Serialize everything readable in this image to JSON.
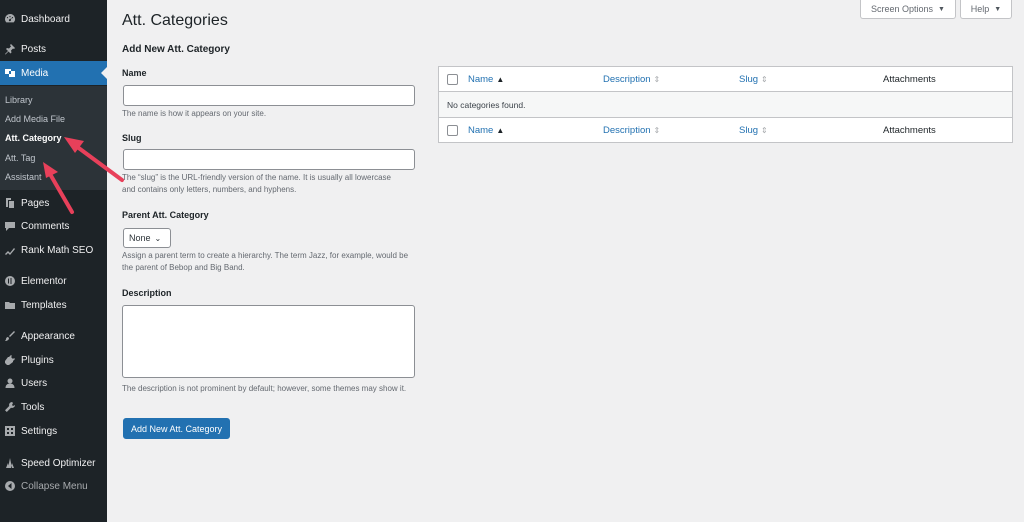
{
  "sidebar": {
    "items": [
      {
        "id": "dashboard",
        "label": "Dashboard",
        "icon": "dashboard-icon"
      },
      {
        "id": "posts",
        "label": "Posts",
        "icon": "pin-icon"
      },
      {
        "id": "media",
        "label": "Media",
        "icon": "media-icon"
      },
      {
        "id": "pages",
        "label": "Pages",
        "icon": "page-icon"
      },
      {
        "id": "comments",
        "label": "Comments",
        "icon": "comment-icon"
      },
      {
        "id": "rankmath",
        "label": "Rank Math SEO",
        "icon": "chart-icon"
      },
      {
        "id": "elementor",
        "label": "Elementor",
        "icon": "elementor-icon"
      },
      {
        "id": "templates",
        "label": "Templates",
        "icon": "folder-icon"
      },
      {
        "id": "appearance",
        "label": "Appearance",
        "icon": "brush-icon"
      },
      {
        "id": "plugins",
        "label": "Plugins",
        "icon": "plug-icon"
      },
      {
        "id": "users",
        "label": "Users",
        "icon": "user-icon"
      },
      {
        "id": "tools",
        "label": "Tools",
        "icon": "wrench-icon"
      },
      {
        "id": "settings",
        "label": "Settings",
        "icon": "settings-icon"
      },
      {
        "id": "speed",
        "label": "Speed Optimizer",
        "icon": "speed-icon"
      },
      {
        "id": "collapse",
        "label": "Collapse Menu",
        "icon": "collapse-icon"
      }
    ],
    "submenu": [
      "Library",
      "Add Media File",
      "Att. Category",
      "Att. Tag",
      "Assistant"
    ]
  },
  "top": {
    "screen_options": "Screen Options",
    "help": "Help"
  },
  "page_title": "Att. Categories",
  "form": {
    "heading": "Add New Att. Category",
    "name_label": "Name",
    "name_help": "The name is how it appears on your site.",
    "slug_label": "Slug",
    "slug_help": "The “slug” is the URL-friendly version of the name. It is usually all lowercase and contains only letters, numbers, and hyphens.",
    "parent_label": "Parent Att. Category",
    "parent_value": "None",
    "parent_help": "Assign a parent term to create a hierarchy. The term Jazz, for example, would be the parent of Bebop and Big Band.",
    "description_label": "Description",
    "description_help": "The description is not prominent by default; however, some themes may show it.",
    "submit": "Add New Att. Category"
  },
  "table": {
    "columns": [
      "Name",
      "Description",
      "Slug",
      "Attachments"
    ],
    "empty": "No categories found."
  },
  "colors": {
    "accent": "#2271b1",
    "sidebar": "#1d2327",
    "annotation_arrow": "#e8405a"
  }
}
